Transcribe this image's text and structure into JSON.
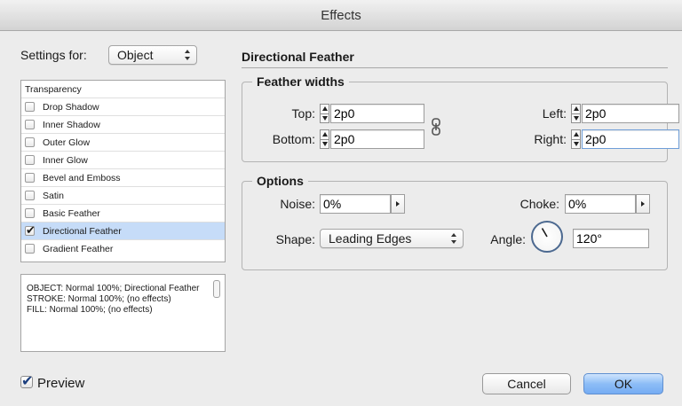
{
  "window": {
    "title": "Effects"
  },
  "settings_for": {
    "label": "Settings for:",
    "value": "Object"
  },
  "effects_list": [
    {
      "label": "Transparency",
      "has_checkbox": false,
      "checked": false,
      "selected": false
    },
    {
      "label": "Drop Shadow",
      "has_checkbox": true,
      "checked": false,
      "selected": false
    },
    {
      "label": "Inner Shadow",
      "has_checkbox": true,
      "checked": false,
      "selected": false
    },
    {
      "label": "Outer Glow",
      "has_checkbox": true,
      "checked": false,
      "selected": false
    },
    {
      "label": "Inner Glow",
      "has_checkbox": true,
      "checked": false,
      "selected": false
    },
    {
      "label": "Bevel and Emboss",
      "has_checkbox": true,
      "checked": false,
      "selected": false
    },
    {
      "label": "Satin",
      "has_checkbox": true,
      "checked": false,
      "selected": false
    },
    {
      "label": "Basic Feather",
      "has_checkbox": true,
      "checked": false,
      "selected": false
    },
    {
      "label": "Directional Feather",
      "has_checkbox": true,
      "checked": true,
      "selected": true
    },
    {
      "label": "Gradient Feather",
      "has_checkbox": true,
      "checked": false,
      "selected": false
    }
  ],
  "summary": {
    "line1": "OBJECT: Normal 100%; Directional Feather",
    "line2": "STROKE: Normal 100%; (no effects)",
    "line3": "FILL: Normal 100%; (no effects)"
  },
  "panel": {
    "title": "Directional Feather",
    "feather_widths": {
      "legend": "Feather widths",
      "top_label": "Top:",
      "top_value": "2p0",
      "bottom_label": "Bottom:",
      "bottom_value": "2p0",
      "left_label": "Left:",
      "left_value": "2p0",
      "right_label": "Right:",
      "right_value": "2p0",
      "link_icon": "chain-link-icon"
    },
    "options": {
      "legend": "Options",
      "noise_label": "Noise:",
      "noise_value": "0%",
      "choke_label": "Choke:",
      "choke_value": "0%",
      "shape_label": "Shape:",
      "shape_value": "Leading Edges",
      "angle_label": "Angle:",
      "angle_value": "120°",
      "angle_degrees": 120
    }
  },
  "footer": {
    "preview_label": "Preview",
    "preview_checked": true,
    "cancel_label": "Cancel",
    "ok_label": "OK"
  },
  "colors": {
    "selection": "#c6dcf8",
    "ok_button": "#8dbdf6",
    "window_bg": "#ececec"
  }
}
